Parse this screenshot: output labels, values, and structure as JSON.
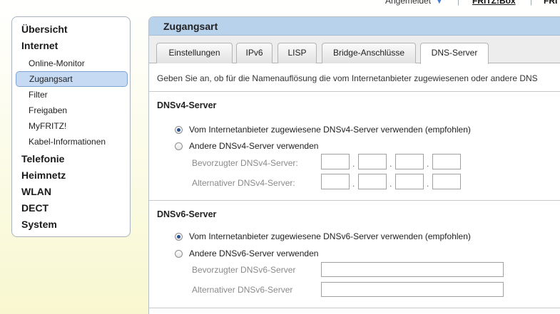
{
  "topbar": {
    "login_label": "Angemeldet",
    "login_arrow": "▼",
    "separator": "|",
    "fritz_link": "FRITZ!Box",
    "more_link": "FRI"
  },
  "sidebar": {
    "items": [
      {
        "label": "Übersicht"
      },
      {
        "label": "Internet"
      },
      {
        "label": "Online-Monitor"
      },
      {
        "label": "Zugangsart"
      },
      {
        "label": "Filter"
      },
      {
        "label": "Freigaben"
      },
      {
        "label": "MyFRITZ!"
      },
      {
        "label": "Kabel-Informationen"
      },
      {
        "label": "Telefonie"
      },
      {
        "label": "Heimnetz"
      },
      {
        "label": "WLAN"
      },
      {
        "label": "DECT"
      },
      {
        "label": "System"
      }
    ],
    "active": "Zugangsart"
  },
  "panel": {
    "title": "Zugangsart",
    "tabs": [
      {
        "label": "Einstellungen"
      },
      {
        "label": "IPv6"
      },
      {
        "label": "LISP"
      },
      {
        "label": "Bridge-Anschlüsse"
      },
      {
        "label": "DNS-Server"
      }
    ],
    "active_tab": "DNS-Server",
    "intro": "Geben Sie an, ob für die Namenauflösung die vom Internetanbieter zugewiesenen oder andere DNS",
    "dnsv4": {
      "title": "DNSv4-Server",
      "option_provider": "Vom Internetanbieter zugewiesene DNSv4-Server verwenden (empfohlen)",
      "option_other": "Andere DNSv4-Server verwenden",
      "preferred_label": "Bevorzugter DNSv4-Server:",
      "alternate_label": "Alternativer DNSv4-Server:",
      "selected": "provider"
    },
    "dnsv6": {
      "title": "DNSv6-Server",
      "option_provider": "Vom Internetanbieter zugewiesene DNSv6-Server verwenden (empfohlen)",
      "option_other": "Andere DNSv6-Server verwenden",
      "preferred_label": "Bevorzugter DNSv6-Server",
      "alternate_label": "Alternativer DNSv6-Server",
      "selected": "provider"
    },
    "ip_separator": "."
  }
}
